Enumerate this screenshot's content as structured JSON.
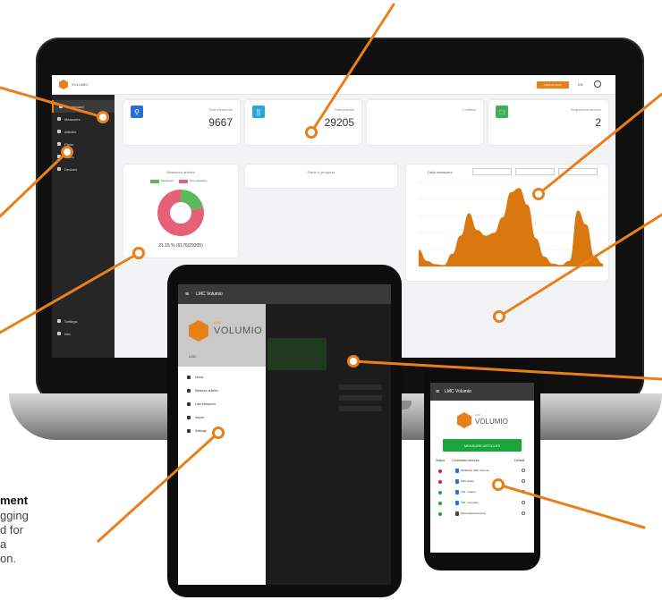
{
  "laptop": {
    "topbar": {
      "brand": "VOLUMIO",
      "action_button": "NEW ACTION",
      "lang": "EN"
    },
    "sidebar": {
      "items": [
        {
          "label": "Dashboard",
          "icon": "dashboard-icon"
        },
        {
          "label": "Measures",
          "icon": "search-icon"
        },
        {
          "label": "Articles",
          "icon": "article-icon"
        },
        {
          "label": "Plans",
          "icon": "calendar-icon"
        },
        {
          "label": "Users",
          "icon": "users-icon"
        },
        {
          "label": "Devices",
          "icon": "device-icon"
        }
      ],
      "bottom_items": [
        {
          "label": "Settings",
          "icon": "gear-icon"
        },
        {
          "label": "Info",
          "icon": "info-icon"
        }
      ]
    },
    "cards": {
      "measures": {
        "label": "Total Measures",
        "value": "9667",
        "color": "#2b6fd6"
      },
      "articles": {
        "label": "Total Articles",
        "value": "29205",
        "color": "#2aa7d6"
      },
      "conflicts": {
        "label": "Conflicts"
      },
      "registered": {
        "label": "Registered devices",
        "value": "2",
        "color": "#3fae54"
      },
      "measured_articles": {
        "label": "Measured articles",
        "legend_a": "Measured",
        "legend_b": "Not measured",
        "percent_text": "21.15 % (6176/29205)"
      },
      "plans": {
        "label": "Plans in progress"
      },
      "daily": {
        "label": "Daily measures"
      }
    },
    "chart_data": {
      "type": "area",
      "title": "Daily measures",
      "color": "#d9780f",
      "grid": true,
      "values": [
        60,
        20,
        8,
        5,
        45,
        110,
        190,
        130,
        110,
        120,
        175,
        265,
        280,
        220,
        100,
        35,
        10,
        5,
        20,
        200,
        150,
        35,
        10
      ],
      "ylim": [
        0,
        300
      ]
    },
    "donut_data": {
      "type": "pie",
      "values": [
        21.15,
        78.85
      ],
      "colors": [
        "#5cb85c",
        "#e76078"
      ]
    }
  },
  "tablet": {
    "topbar_title": "LMC Volumio",
    "brand_small": "LMC",
    "brand": "VOLUMIO",
    "user": "LMC",
    "menu": [
      {
        "label": "Home",
        "icon": "home-icon"
      },
      {
        "label": "Measure articles",
        "icon": "plus-icon"
      },
      {
        "label": "Last Measures",
        "icon": "history-icon"
      },
      {
        "label": "Import",
        "icon": "download-icon"
      },
      {
        "label": "Settings",
        "icon": "gear-icon"
      }
    ]
  },
  "phone": {
    "topbar_title": "LMC Volumio",
    "brand_small": "LMC",
    "brand": "VOLUMIO",
    "measure_button": "MEASURE ARTICLES",
    "table_headers": {
      "status": "Status",
      "device": "Connected devices",
      "default": "Default"
    },
    "devices": [
      {
        "name": "MultiScan LMC Volumio",
        "status_color": "#d6202a"
      },
      {
        "name": "LMC Scale",
        "status_color": "#d6202a"
      },
      {
        "name": "VID - Output",
        "status_color": "#1aa53a"
      },
      {
        "name": "VID - Compare",
        "status_color": "#1aa53a"
      },
      {
        "name": "Parcel Dimensioning",
        "status_color": "#1aa53a"
      }
    ]
  },
  "side_text": {
    "heading": "ment",
    "lines": [
      "gging",
      "d for",
      "a",
      "on."
    ]
  },
  "accent": "#e8801a"
}
